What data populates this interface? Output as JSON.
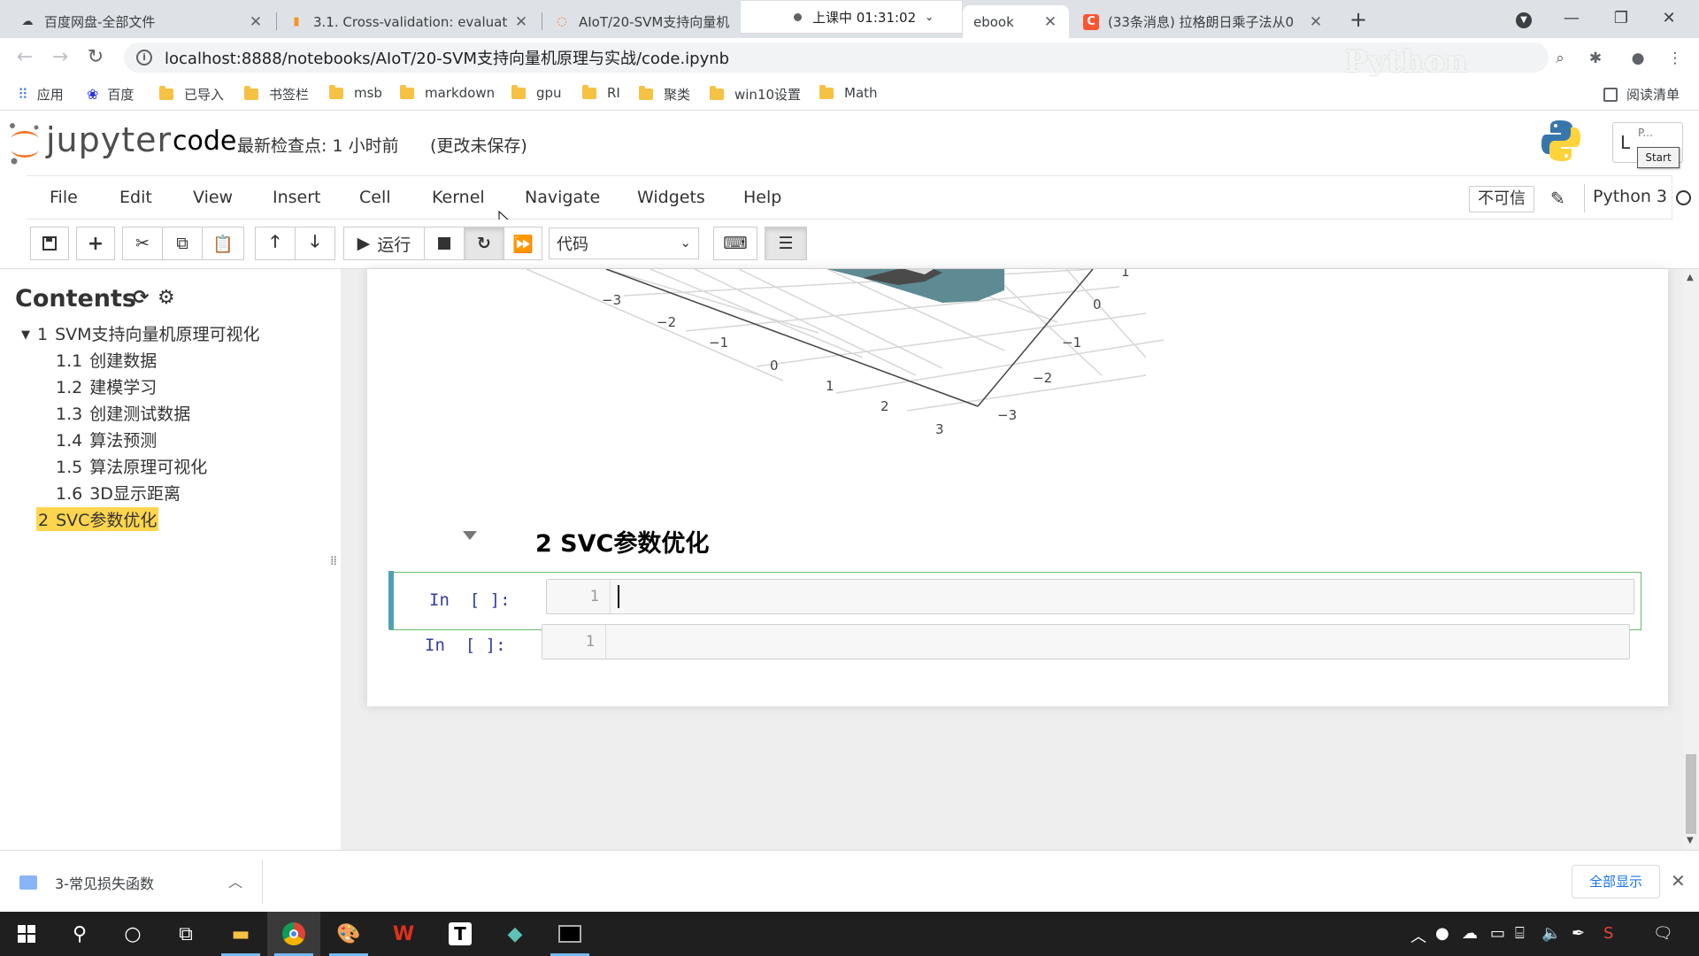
{
  "browser": {
    "tabs": [
      {
        "title": "百度网盘-全部文件",
        "favicon": "baidu-pan-icon"
      },
      {
        "title": "3.1. Cross-validation: evaluati",
        "favicon": "sklearn-icon"
      },
      {
        "title": "AIoT/20-SVM支持向量机原",
        "favicon": "jupyter-icon"
      },
      {
        "title": "ebook",
        "favicon": ""
      },
      {
        "title": "(33条消息) 拉格朗日乘子法从0",
        "favicon": "csdn-icon"
      }
    ],
    "timer_text": "上课中 01:31:02",
    "url": "localhost:8888/notebooks/AIoT/20-SVM支持向量机原理与实战/code.ipynb",
    "watermark": "Python",
    "bookmarks": [
      "应用",
      "百度",
      "已导入",
      "书签栏",
      "msb",
      "markdown",
      "gpu",
      "RI",
      "聚类",
      "win10设置",
      "Math"
    ],
    "reading_list": "阅读清单"
  },
  "jupyter": {
    "brand": "jupyter",
    "notebook_name": "code",
    "checkpoint": "最新检查点: 1 小时前",
    "unsaved": "(更改未保存)",
    "logout_initial": "L",
    "overlay_p": "P...",
    "start_label": "Start",
    "menus": [
      "File",
      "Edit",
      "View",
      "Insert",
      "Cell",
      "Kernel",
      "Navigate",
      "Widgets",
      "Help"
    ],
    "trusted": "不可信",
    "kernel": "Python 3",
    "run_label": "运行",
    "cell_type": "代码"
  },
  "toc": {
    "title": "Contents",
    "items": [
      {
        "num": "1",
        "label": "SVM支持向量机原理可视化"
      },
      {
        "num": "1.1",
        "label": "创建数据"
      },
      {
        "num": "1.2",
        "label": "建模学习"
      },
      {
        "num": "1.3",
        "label": "创建测试数据"
      },
      {
        "num": "1.4",
        "label": "算法预测"
      },
      {
        "num": "1.5",
        "label": "算法原理可视化"
      },
      {
        "num": "1.6",
        "label": "3D显示距离"
      },
      {
        "num": "2",
        "label": "SVC参数优化"
      }
    ]
  },
  "plot": {
    "left_ticks": [
      "−3",
      "−2",
      "−1",
      "0",
      "1",
      "2",
      "3"
    ],
    "right_ticks": [
      "1",
      "0",
      "−1",
      "−2",
      "−3"
    ],
    "colors": {
      "surface": "#5e8a93",
      "dark": "#4a4a4a"
    }
  },
  "notebook": {
    "heading": "2  SVC参数优化",
    "cells": [
      {
        "prompt": "In  [ ]:",
        "line": "1"
      },
      {
        "prompt": "In  [ ]:",
        "line": "1"
      }
    ]
  },
  "shelf": {
    "download": "3-常见损失函数",
    "show_all": "全部显示"
  }
}
